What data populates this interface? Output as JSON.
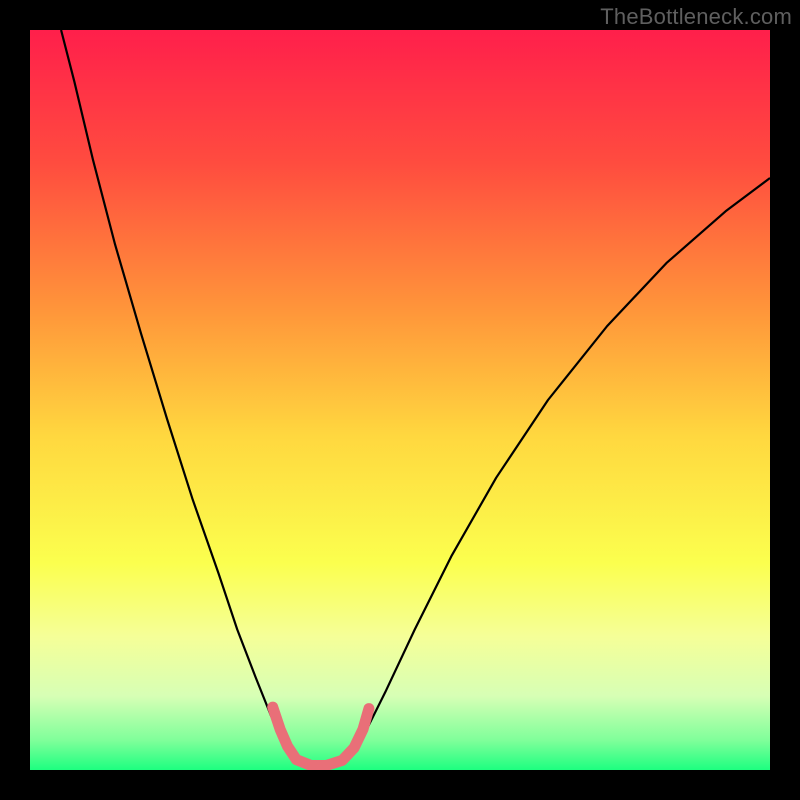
{
  "watermark": "TheBottleneck.com",
  "chart_data": {
    "type": "line",
    "title": "",
    "xlabel": "",
    "ylabel": "",
    "xlim": [
      0,
      100
    ],
    "ylim": [
      0,
      100
    ],
    "background_gradient": {
      "stops": [
        {
          "offset": 0,
          "color": "#ff1f4b"
        },
        {
          "offset": 0.18,
          "color": "#ff4c3f"
        },
        {
          "offset": 0.38,
          "color": "#ff963a"
        },
        {
          "offset": 0.55,
          "color": "#ffd83f"
        },
        {
          "offset": 0.72,
          "color": "#fbff4e"
        },
        {
          "offset": 0.82,
          "color": "#f5ff98"
        },
        {
          "offset": 0.9,
          "color": "#d7ffb5"
        },
        {
          "offset": 0.96,
          "color": "#7fff9a"
        },
        {
          "offset": 1.0,
          "color": "#1dff80"
        }
      ]
    },
    "series": [
      {
        "name": "left-arm",
        "color": "#000000",
        "width": 2.2,
        "points": [
          {
            "x": 4.2,
            "y": 100.0
          },
          {
            "x": 6.0,
            "y": 93.0
          },
          {
            "x": 8.5,
            "y": 82.5
          },
          {
            "x": 11.5,
            "y": 71.0
          },
          {
            "x": 15.0,
            "y": 59.0
          },
          {
            "x": 18.5,
            "y": 47.5
          },
          {
            "x": 22.0,
            "y": 36.5
          },
          {
            "x": 25.5,
            "y": 26.5
          },
          {
            "x": 28.0,
            "y": 19.0
          },
          {
            "x": 30.5,
            "y": 12.5
          },
          {
            "x": 32.5,
            "y": 7.5
          },
          {
            "x": 34.0,
            "y": 4.2
          },
          {
            "x": 35.5,
            "y": 2.0
          },
          {
            "x": 37.0,
            "y": 0.8
          },
          {
            "x": 38.5,
            "y": 0.3
          }
        ]
      },
      {
        "name": "right-arm",
        "color": "#000000",
        "width": 2.2,
        "points": [
          {
            "x": 38.5,
            "y": 0.3
          },
          {
            "x": 41.0,
            "y": 0.5
          },
          {
            "x": 43.0,
            "y": 1.8
          },
          {
            "x": 45.0,
            "y": 4.5
          },
          {
            "x": 48.0,
            "y": 10.5
          },
          {
            "x": 52.0,
            "y": 19.0
          },
          {
            "x": 57.0,
            "y": 29.0
          },
          {
            "x": 63.0,
            "y": 39.5
          },
          {
            "x": 70.0,
            "y": 50.0
          },
          {
            "x": 78.0,
            "y": 60.0
          },
          {
            "x": 86.0,
            "y": 68.5
          },
          {
            "x": 94.0,
            "y": 75.5
          },
          {
            "x": 100.0,
            "y": 80.0
          }
        ]
      },
      {
        "name": "marker-strip",
        "color": "#e96f78",
        "width": 11,
        "cap": "round",
        "points": [
          {
            "x": 32.8,
            "y": 8.5
          },
          {
            "x": 33.8,
            "y": 5.5
          },
          {
            "x": 34.8,
            "y": 3.2
          },
          {
            "x": 36.0,
            "y": 1.4
          },
          {
            "x": 38.0,
            "y": 0.6
          },
          {
            "x": 40.0,
            "y": 0.6
          },
          {
            "x": 42.2,
            "y": 1.3
          },
          {
            "x": 43.8,
            "y": 3.0
          },
          {
            "x": 45.0,
            "y": 5.5
          },
          {
            "x": 45.8,
            "y": 8.3
          }
        ]
      }
    ]
  }
}
